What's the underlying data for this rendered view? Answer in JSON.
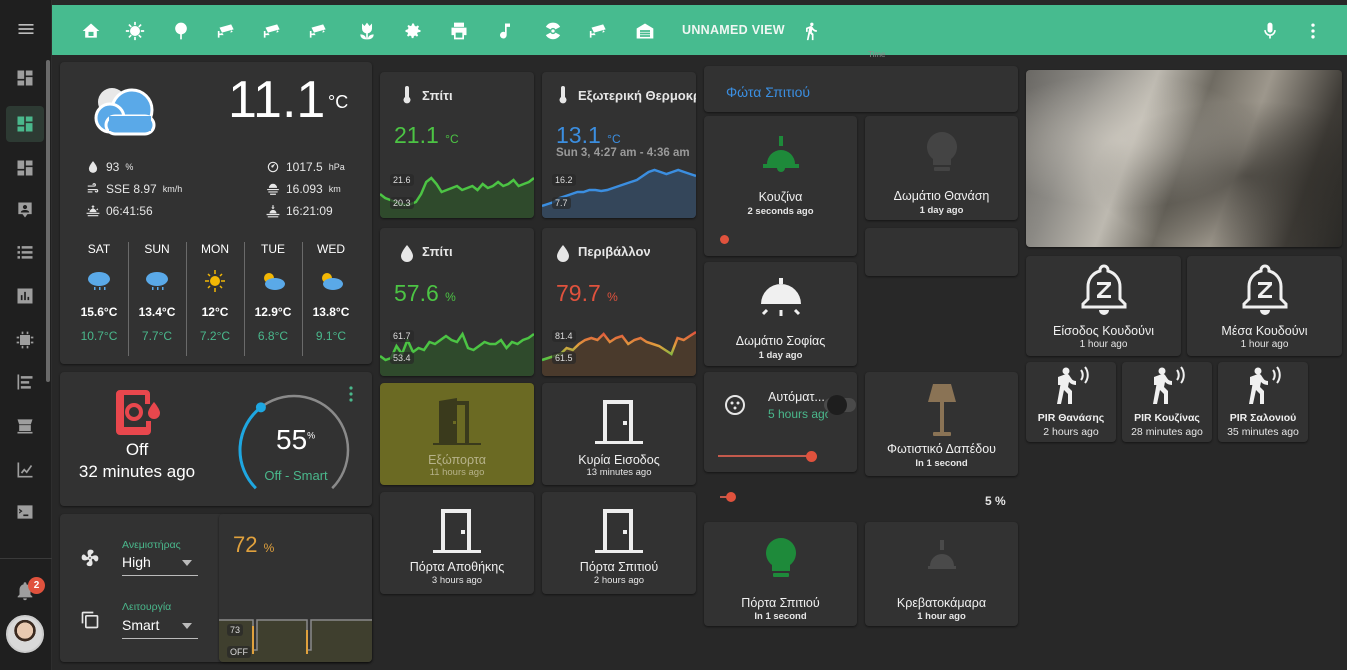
{
  "topbar": {
    "view_title": "UNNAMED VIEW",
    "tab_icons": [
      "home-icon",
      "virus-icon",
      "tree-icon",
      "cctv-icon",
      "cctv-icon",
      "cctv-icon",
      "tulip-icon",
      "gear-icon",
      "printer-icon",
      "music-note-icon",
      "radioactive-icon",
      "cctv-icon",
      "garage-icon"
    ],
    "walk_icon": "walk-icon",
    "mic_icon": "microphone-icon",
    "more_icon": "dots-vertical-icon"
  },
  "sidebar": {
    "items": [
      "dashboard-icon",
      "dashboard-icon",
      "dashboard-icon",
      "account-box-icon",
      "list-icon",
      "chart-box-icon",
      "memory-icon",
      "format-list-icon",
      "hacs-icon",
      "chart-line-icon",
      "terminal-icon"
    ],
    "notification_count": "2"
  },
  "weather": {
    "temp": "11.1",
    "unit": "°C",
    "humidity": "93",
    "humidity_unit": "%",
    "wind": "SSE 8.97",
    "wind_unit": "km/h",
    "sunrise": "06:41:56",
    "pressure": "1017.5",
    "pressure_unit": "hPa",
    "visibility": "16.093",
    "visibility_unit": "km",
    "sunset": "16:21:09",
    "forecast": [
      {
        "day": "SAT",
        "hi": "15.6°C",
        "lo": "10.7°C"
      },
      {
        "day": "SUN",
        "hi": "13.4°C",
        "lo": "7.7°C"
      },
      {
        "day": "MON",
        "hi": "12°C",
        "lo": "7.2°C"
      },
      {
        "day": "TUE",
        "hi": "12.9°C",
        "lo": "6.8°C"
      },
      {
        "day": "WED",
        "hi": "13.8°C",
        "lo": "9.1°C"
      }
    ]
  },
  "humidifier": {
    "state": "Off",
    "time": "32 minutes ago",
    "level": "55",
    "level_unit": "%",
    "mode": "Off - Smart",
    "level_fraction": 0.55
  },
  "fan": {
    "speed_label": "Ανεμιστήρας",
    "speed_value": "High",
    "mode_label": "Λειτουργία",
    "mode_value": "Smart",
    "graph_value": "72",
    "graph_unit": "%",
    "graph_max": "73",
    "graph_min": "OFF"
  },
  "sensors": [
    {
      "name": "Σπίτι",
      "value": "21.1",
      "unit": "°C",
      "max": "21.6",
      "min": "20.3",
      "color": "#4cc444"
    },
    {
      "name": "Εξωτερική Θερμοκρασία",
      "value": "13.1",
      "unit": "°C",
      "sub": "Sun 3, 4:27 am - 4:36 am",
      "max": "16.2",
      "min": "7.7",
      "color": "#3b8ee0"
    },
    {
      "name": "Σπίτι",
      "value": "57.6",
      "unit": "%",
      "max": "61.7",
      "min": "53.4",
      "color": "#4cc444"
    },
    {
      "name": "Περιβάλλον",
      "value": "79.7",
      "unit": "%",
      "max": "81.4",
      "min": "61.5",
      "color": "#e0523d"
    }
  ],
  "doors": [
    {
      "name": "Εξώπορτα",
      "time": "11 hours ago"
    },
    {
      "name": "Κυρία Εισοδος",
      "time": "13 minutes ago"
    },
    {
      "name": "Πόρτα Αποθήκης",
      "time": "3 hours ago"
    },
    {
      "name": "Πόρτα Σπιτιού",
      "time": "2 hours ago"
    }
  ],
  "lights": {
    "title": "Φώτα Σπιτιού",
    "header_time": "Time",
    "items": [
      {
        "name": "Κουζίνα",
        "time": "2 seconds ago"
      },
      {
        "name": "Δωμάτιο Θανάση",
        "time": "1 day ago"
      },
      {
        "name": "Δωμάτιο Σοφίας",
        "time": "1 day ago"
      },
      {
        "name": "Φωτιστικό Δαπέδου",
        "time": "In 1 second"
      },
      {
        "name": "Πόρτα Σπιτιού",
        "time": "In 1 second"
      },
      {
        "name": "Κρεβατοκάμαρα",
        "time": "1 hour ago"
      }
    ],
    "auto_name": "Αυτόματ...",
    "auto_time": "5 hours ago",
    "slider_percent": "5 %"
  },
  "doorbells": [
    {
      "name": "Είσοδος Κουδούνι",
      "time": "1 hour ago"
    },
    {
      "name": "Μέσα Κουδούνι",
      "time": "1 hour ago"
    }
  ],
  "pirs": [
    {
      "name": "PIR Θανάσης",
      "time": "2 hours ago"
    },
    {
      "name": "PIR Κουζίνας",
      "time": "28 minutes ago"
    },
    {
      "name": "PIR Σαλονιού",
      "time": "35 minutes ago"
    }
  ]
}
